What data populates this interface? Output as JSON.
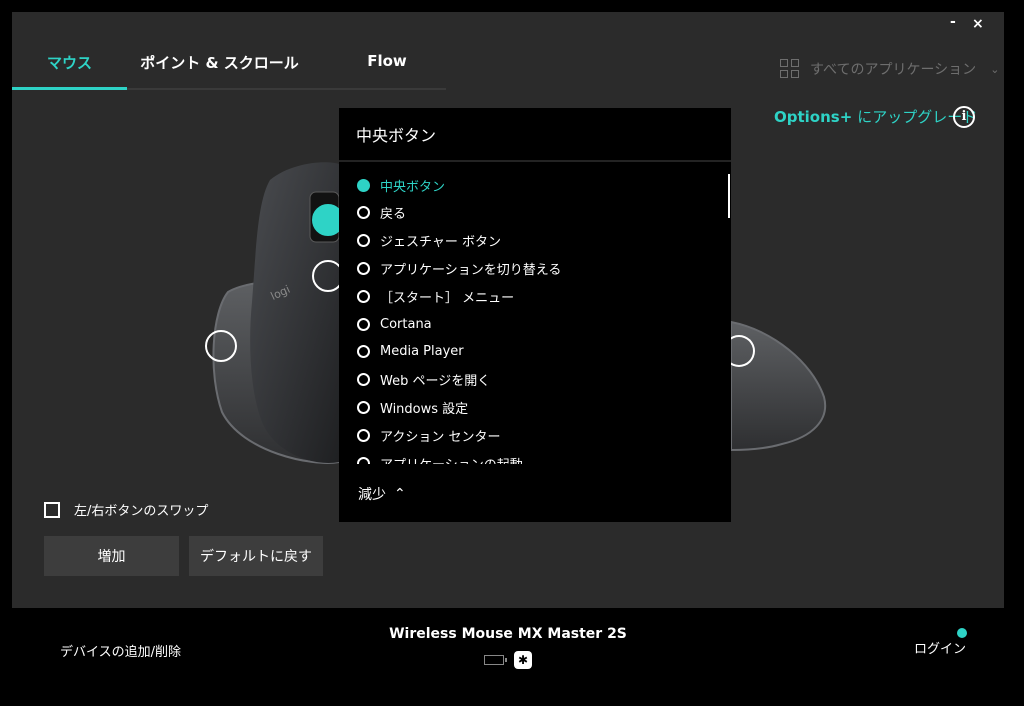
{
  "window": {
    "minimize": "-",
    "close": "×"
  },
  "tabs": [
    {
      "label": "マウス",
      "active": true
    },
    {
      "label": "ポイント & スクロール"
    },
    {
      "label": "Flow"
    }
  ],
  "app_selector": {
    "label": "すべてのアプリケーション"
  },
  "upgrade": {
    "brand": "Options+",
    "text": "にアップグレード"
  },
  "info": "i",
  "swap": {
    "label": "左/右ボタンのスワップ",
    "checked": false
  },
  "buttons": {
    "add": "増加",
    "default": "デフォルトに戻す"
  },
  "dropdown": {
    "title": "中央ボタン",
    "options": [
      "中央ボタン",
      "戻る",
      "ジェスチャー ボタン",
      "アプリケーションを切り替える",
      "［スタート］ メニュー",
      "Cortana",
      "Media Player",
      "Web ページを開く",
      "Windows 設定",
      "アクション センター",
      "アプリケーションの起動"
    ],
    "selected": 0,
    "less": "減少"
  },
  "mouse_logo": "logi",
  "footer": {
    "add_device": "デバイスの追加/削除",
    "device_name": "Wireless Mouse MX Master 2S",
    "login": "ログイン"
  },
  "colors": {
    "accent": "#2ed3c6",
    "panel": "#2b2b2b",
    "dropdown": "#000000"
  }
}
